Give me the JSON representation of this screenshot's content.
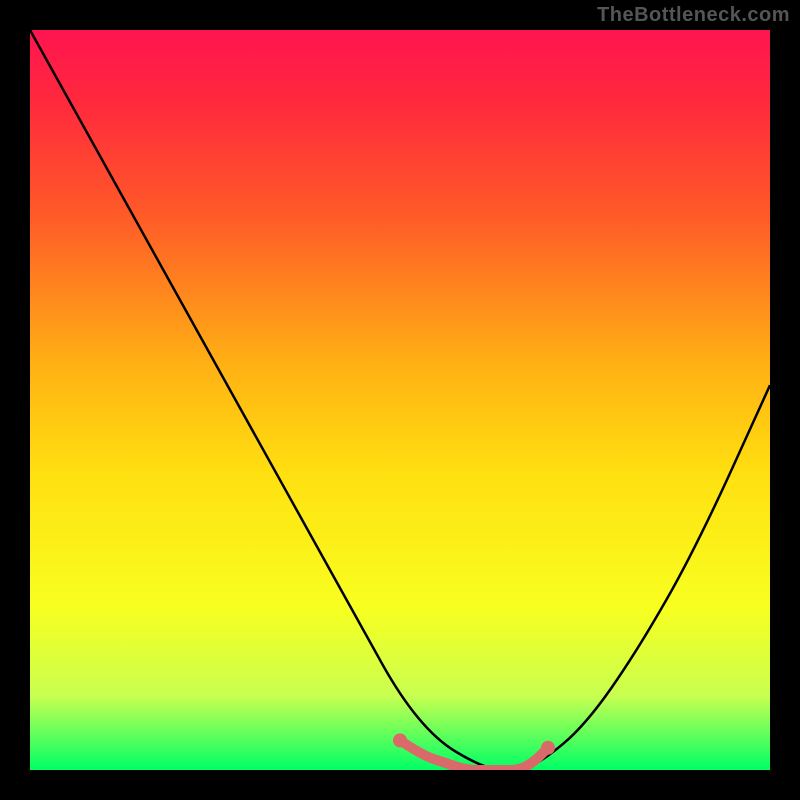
{
  "watermark": "TheBottleneck.com",
  "chart_data": {
    "type": "line",
    "title": "",
    "xlabel": "",
    "ylabel": "",
    "xlim": [
      0,
      100
    ],
    "ylim": [
      0,
      100
    ],
    "background_gradient": {
      "stops": [
        {
          "offset": 0.0,
          "color": "#ff1450"
        },
        {
          "offset": 0.1,
          "color": "#ff2a3c"
        },
        {
          "offset": 0.25,
          "color": "#ff5a28"
        },
        {
          "offset": 0.45,
          "color": "#ffb014"
        },
        {
          "offset": 0.6,
          "color": "#ffe010"
        },
        {
          "offset": 0.78,
          "color": "#f8ff20"
        },
        {
          "offset": 0.9,
          "color": "#c8ff50"
        },
        {
          "offset": 1.0,
          "color": "#00ff66"
        }
      ]
    },
    "series": [
      {
        "name": "bottleneck-curve",
        "color": "#000000",
        "x": [
          0,
          10,
          20,
          30,
          40,
          45,
          50,
          55,
          60,
          63,
          66,
          69,
          75,
          82,
          90,
          100
        ],
        "values": [
          100,
          82,
          64,
          46,
          28,
          19,
          10,
          4,
          1,
          0,
          0,
          1,
          6,
          16,
          30,
          52
        ]
      }
    ],
    "optimal_band": {
      "name": "optimal-zone",
      "color": "#da6a6a",
      "x": [
        50,
        53,
        56,
        59,
        62,
        64,
        66,
        68,
        70
      ],
      "values": [
        4,
        2,
        1,
        0,
        0,
        0,
        0,
        1,
        3
      ],
      "markers_x": [
        50,
        70
      ],
      "markers_y": [
        4,
        3
      ]
    }
  }
}
